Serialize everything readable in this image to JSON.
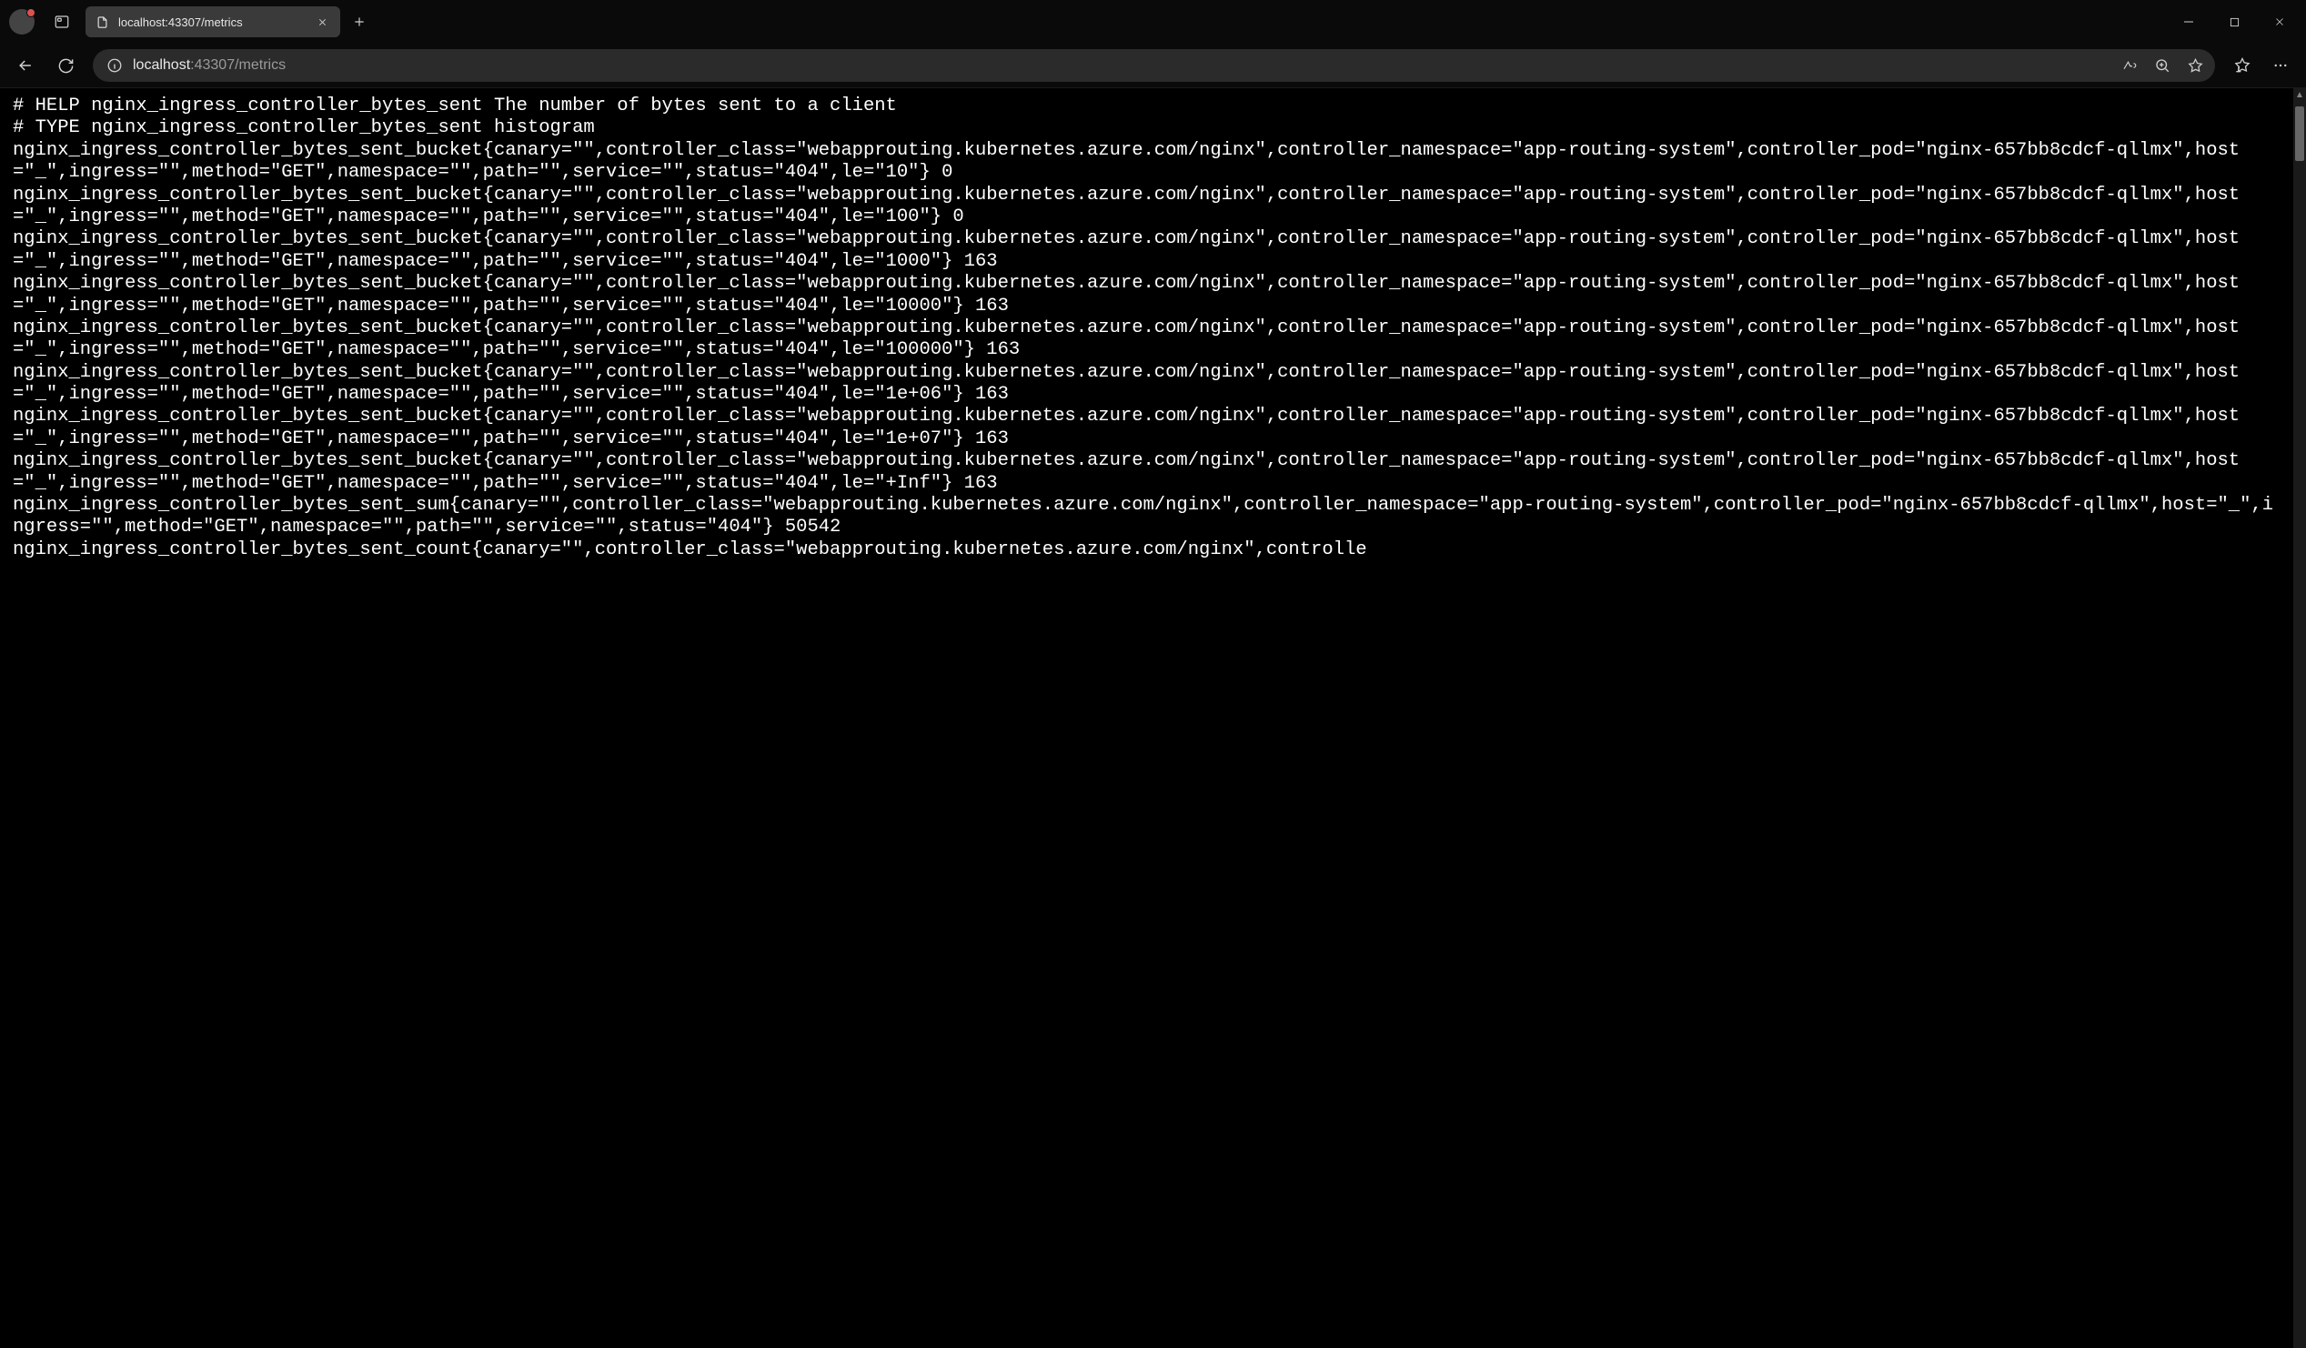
{
  "tab": {
    "title": "localhost:43307/metrics"
  },
  "address": {
    "host": "localhost",
    "path": ":43307/metrics"
  },
  "metrics": {
    "help": "# HELP nginx_ingress_controller_bytes_sent The number of bytes sent to a client",
    "type": "# TYPE nginx_ingress_controller_bytes_sent histogram",
    "common": {
      "metric_prefix": "nginx_ingress_controller_bytes_sent",
      "canary": "",
      "controller_class": "webapprouting.kubernetes.azure.com/nginx",
      "controller_namespace": "app-routing-system",
      "controller_pod": "nginx-657bb8cdcf-qllmx",
      "host": "_",
      "ingress": "",
      "method": "GET",
      "namespace": "",
      "path": "",
      "service": "",
      "status": "404"
    },
    "buckets": [
      {
        "le": "10",
        "value": 0
      },
      {
        "le": "100",
        "value": 0
      },
      {
        "le": "1000",
        "value": 163
      },
      {
        "le": "10000",
        "value": 163
      },
      {
        "le": "100000",
        "value": 163
      },
      {
        "le": "1e+06",
        "value": 163
      },
      {
        "le": "1e+07",
        "value": 163
      },
      {
        "le": "+Inf",
        "value": 163
      }
    ],
    "sum": 50542,
    "count_trailing": "nginx_ingress_controller_bytes_sent_count{canary=\"\",controller_class=\"webapprouting.kubernetes.azure.com/nginx\",controlle"
  }
}
